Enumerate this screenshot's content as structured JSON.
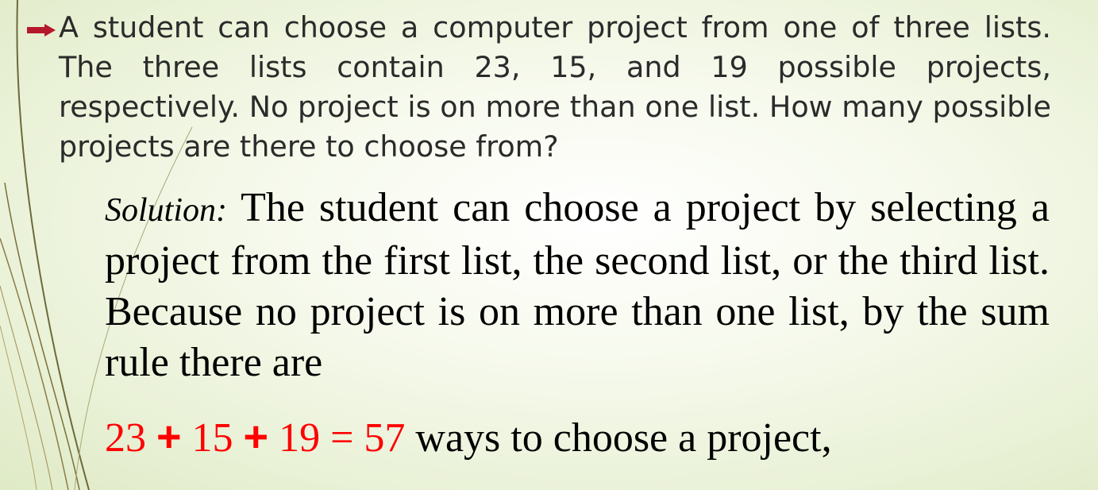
{
  "problem": {
    "bullet_icon": "arrow-bullet-icon",
    "text": "A student can choose a computer project from one of three lists. The three lists contain 23, 15, and 19 possible projects, respectively. No project is on more than one list. How many possible projects are there to choose from?"
  },
  "solution": {
    "label": "Solution:",
    "text": "The student can choose a project by selecting a project from the first list, the second list, or the third list. Because no project is on more than one list, by the sum rule there are"
  },
  "equation": {
    "term1": "23",
    "plus1": "+",
    "term2": "15",
    "plus2": "+",
    "term3": "19 = 57",
    "suffix": "ways to choose a project,"
  },
  "colors": {
    "accent_red": "#ff0000",
    "bullet": "#b5182b",
    "deco_lines": "#6b7a3c"
  }
}
